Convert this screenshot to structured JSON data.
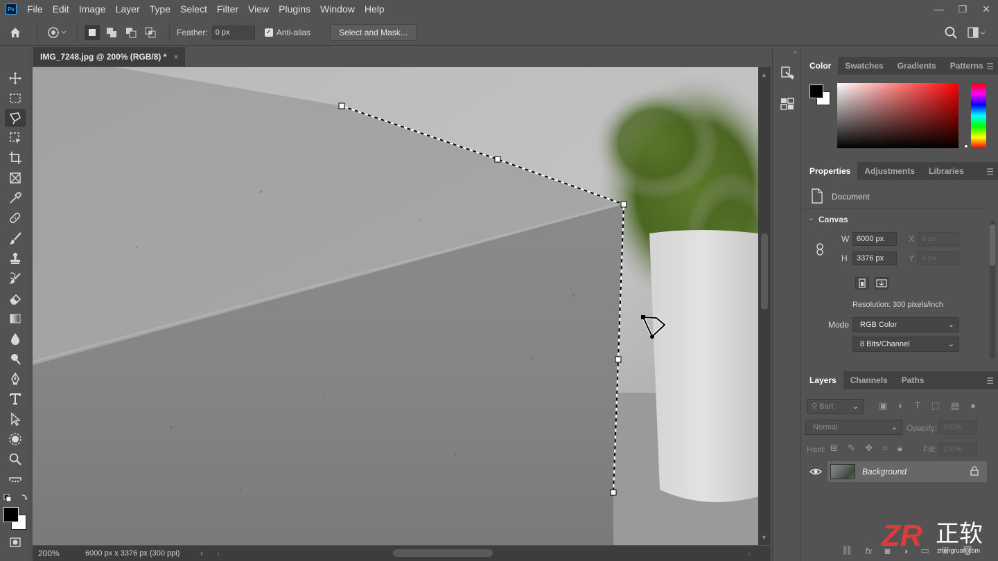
{
  "app": {
    "logo_text": "Ps"
  },
  "menu": [
    "File",
    "Edit",
    "Image",
    "Layer",
    "Type",
    "Select",
    "Filter",
    "View",
    "Plugins",
    "Window",
    "Help"
  ],
  "window_controls": {
    "minimize": "—",
    "restore": "❐",
    "close": "✕"
  },
  "options": {
    "feather_label": "Feather:",
    "feather_value": "0 px",
    "anti_alias_label": "Anti-alias",
    "anti_alias_checked": true,
    "select_mask_label": "Select and Mask..."
  },
  "document": {
    "tab_title": "IMG_7248.jpg @ 200% (RGB/8) *",
    "close": "×",
    "zoom": "200%",
    "dimensions": "6000 px x 3376 px (300 ppi)"
  },
  "color_panel": {
    "tabs": [
      "Color",
      "Swatches",
      "Gradients",
      "Patterns"
    ],
    "active_tab": 0,
    "foreground": "#000000",
    "background": "#ffffff",
    "hue_color": "#ff0000"
  },
  "properties_panel": {
    "tabs": [
      "Properties",
      "Adjustments",
      "Libraries"
    ],
    "active_tab": 0,
    "doc_label": "Document",
    "canvas_section": "Canvas",
    "w_label": "W",
    "w_value": "6000 px",
    "h_label": "H",
    "h_value": "3376 px",
    "x_label": "X",
    "x_value": "0 px",
    "y_label": "Y",
    "y_value": "0 px",
    "resolution": "Resolution: 300 pixels/inch",
    "mode_label": "Mode",
    "mode_value": "RGB Color",
    "bits_value": "8 Bits/Channel"
  },
  "layers_panel": {
    "tabs": [
      "Layers",
      "Channels",
      "Paths"
    ],
    "active_tab": 0,
    "filter_placeholder": "Bart",
    "blend_mode": "Normal",
    "opacity_label": "Opacity:",
    "opacity_value": "100%",
    "lock_label": "Hast:",
    "fill_label": "Fill:",
    "fill_value": "100%",
    "layers": [
      {
        "name": "Background",
        "visible": true,
        "locked": true
      }
    ]
  },
  "watermark": {
    "logo": "ZR",
    "text": "正软",
    "url": "zhengruan.com"
  }
}
